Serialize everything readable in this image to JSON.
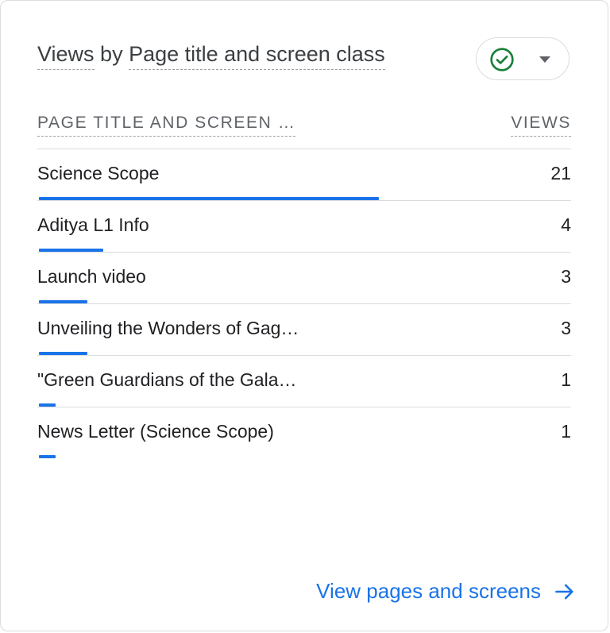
{
  "card": {
    "title_prefix": "Views",
    "title_by": " by ",
    "title_dimension": "Page title and screen class",
    "filter_status_icon": "check-circle-icon",
    "filter_dropdown_icon": "caret-down-icon"
  },
  "table": {
    "column_left": "PAGE TITLE AND SCREEN …",
    "column_right": "VIEWS",
    "rows": [
      {
        "label": "Science Scope",
        "value": "21",
        "bar_fraction": 1.0
      },
      {
        "label": "Aditya L1 Info",
        "value": "4",
        "bar_fraction": 0.19
      },
      {
        "label": "Launch video",
        "value": "3",
        "bar_fraction": 0.143
      },
      {
        "label": "Unveiling the Wonders of Gag…",
        "value": "3",
        "bar_fraction": 0.143
      },
      {
        "label": "\"Green Guardians of the Gala…",
        "value": "1",
        "bar_fraction": 0.048
      },
      {
        "label": "News Letter (Science Scope)",
        "value": "1",
        "bar_fraction": 0.048
      }
    ]
  },
  "footer": {
    "link_label": "View pages and screens",
    "link_icon": "arrow-right-icon"
  },
  "colors": {
    "accent": "#1a73e8",
    "success": "#188038",
    "border": "#dadce0"
  }
}
